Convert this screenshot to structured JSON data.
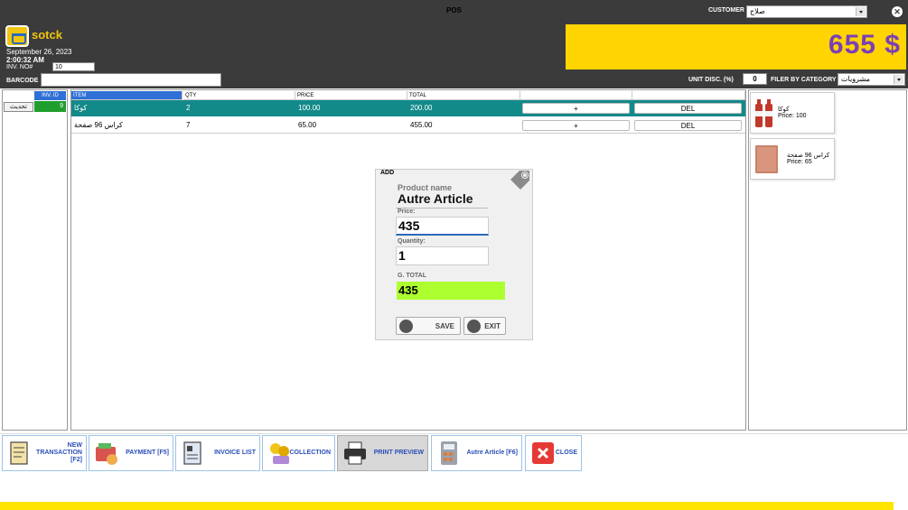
{
  "window": {
    "title": "POS"
  },
  "customer": {
    "label": "CUSTOMER",
    "value": "صلاح"
  },
  "brand": {
    "name": "sotck"
  },
  "session": {
    "date": "September 26, 2023",
    "time": "2:00:32 AM",
    "inv_label": "INV. NO#",
    "inv_value": "10"
  },
  "barcode": {
    "label": "BARCODE",
    "value": ""
  },
  "total": {
    "value": "655 $",
    "color": "#7b3fb5",
    "background": "#ffd400"
  },
  "discount": {
    "label": "UNIT DISC. (%)",
    "value": "0"
  },
  "filter": {
    "label": "FILER BY CATEGORY",
    "value": "مشروبات"
  },
  "invoices": {
    "header": "INV. ID",
    "refresh_label": "تحديث",
    "rows": [
      {
        "id": "9"
      }
    ]
  },
  "grid": {
    "columns": [
      "ITEM",
      "QTY",
      "PRICE",
      "TOTAL",
      "",
      ""
    ],
    "rows": [
      {
        "item": "كوكا",
        "qty": "2",
        "price": "100.00",
        "total": "200.00",
        "add": "+",
        "del": "DEL"
      },
      {
        "item": "كراس 96 صفحة",
        "qty": "7",
        "price": "65.00",
        "total": "455.00",
        "add": "+",
        "del": "DEL"
      }
    ]
  },
  "products": [
    {
      "name": "كوكا",
      "price": "Price: 100",
      "icon": "cola-bottles-icon"
    },
    {
      "name": "كراس 96 صفحة",
      "price": "Price: 65",
      "icon": "notebook-icon"
    }
  ],
  "add_dialog": {
    "title": "ADD",
    "product_label": "Product name",
    "product_name": "Autre Article",
    "price_label": "Price:",
    "price_value": "435",
    "qty_label": "Quantity:",
    "qty_value": "1",
    "gtotal_label": "G. TOTAL",
    "gtotal_value": "435",
    "save_label": "SAVE",
    "exit_label": "EXIT"
  },
  "toolbar": {
    "new_transaction": "NEW TRANSACTION [F2]",
    "payment": "PAYMENT [F5]",
    "invoice_list": "INVOICE LIST",
    "collection": "COLLECTION",
    "print_preview": "PRINT PREVIEW",
    "autre_article": "Autre Article [F6]",
    "close": "CLOSE"
  }
}
